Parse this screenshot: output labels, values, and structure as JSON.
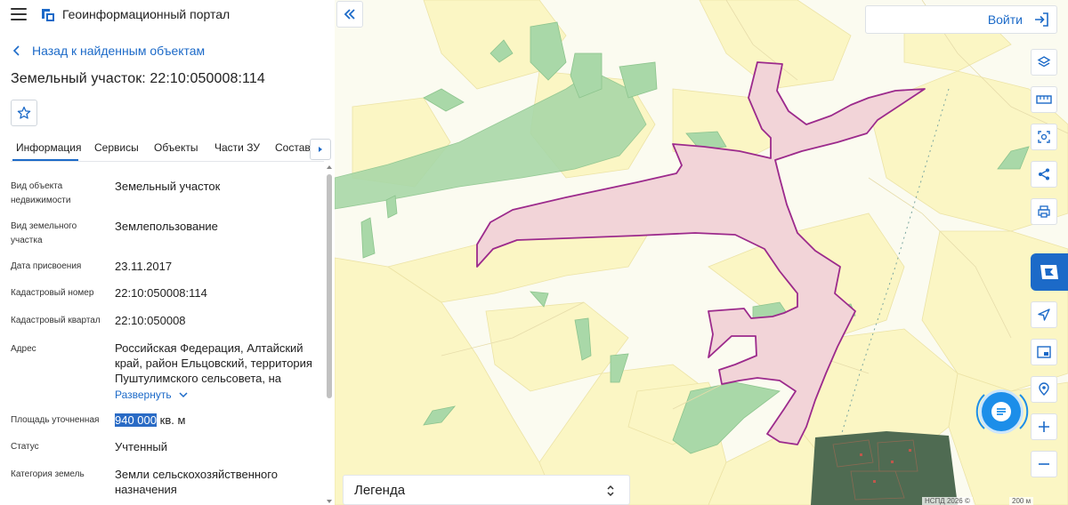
{
  "header": {
    "menu_icon": "hamburger-icon",
    "logo_icon": "geoportal-logo-icon",
    "title": "Геоинформационный портал"
  },
  "nav": {
    "back_label": "Назад к найденным объектам"
  },
  "object": {
    "title": "Земельный участок: 22:10:050008:114"
  },
  "tabs": [
    {
      "label": "Информация",
      "active": true
    },
    {
      "label": "Сервисы"
    },
    {
      "label": "Объекты"
    },
    {
      "label": "Части ЗУ"
    },
    {
      "label": "Состав"
    }
  ],
  "properties": [
    {
      "label": "Вид объекта недвижимости",
      "value": "Земельный участок"
    },
    {
      "label": "Вид земельного участка",
      "value": "Землепользование"
    },
    {
      "label": "Дата присвоения",
      "value": "23.11.2017"
    },
    {
      "label": "Кадастровый номер",
      "value": "22:10:050008:114"
    },
    {
      "label": "Кадастровый квартал",
      "value": "22:10:050008"
    },
    {
      "label": "Адрес",
      "value": "Российская Федерация, Алтайский край, район Ельцовский, территория Пуштулимского сельсовета, на"
    },
    {
      "label": "Площадь уточненная",
      "value_highlight": "940 000",
      "value_unit": "кв. м"
    },
    {
      "label": "Статус",
      "value": "Учтенный"
    },
    {
      "label": "Категория земель",
      "value": "Земли сельскохозяйственного назначения"
    }
  ],
  "expand_label": "Развернуть",
  "map": {
    "login_label": "Войти",
    "legend_label": "Легенда",
    "attribution": "НСПД 2026 ©",
    "scale_label": "200 м",
    "tool_icons": [
      "layers-icon",
      "ruler-icon",
      "area-select-icon",
      "share-icon",
      "print-icon",
      "navigate-icon",
      "minimap-icon",
      "location-icon",
      "zoom-in-icon",
      "zoom-out-icon"
    ],
    "colors": {
      "background": "#fbfbf0",
      "agri_land": "#fbf6c4",
      "forest": "#a9d8a8",
      "parcel_fill": "#f2d4d8",
      "parcel_stroke": "#9c2a8c",
      "accent": "#1c6ac8"
    }
  }
}
